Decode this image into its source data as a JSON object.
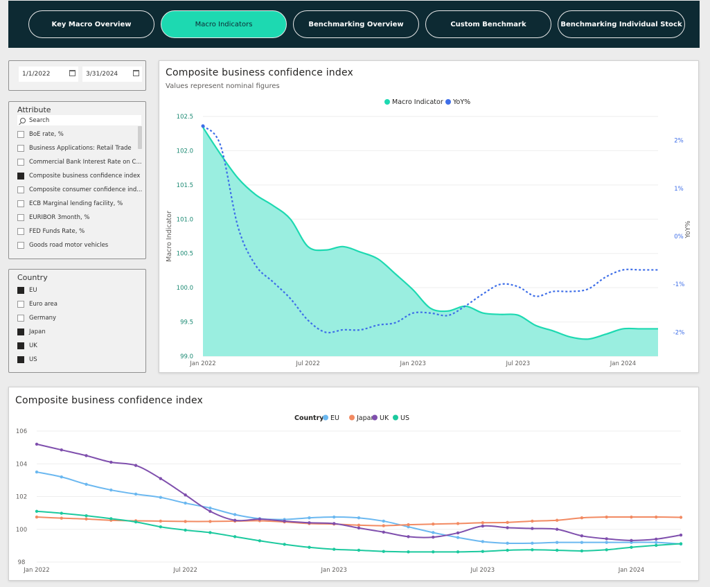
{
  "nav": {
    "tabs": [
      {
        "label": "Key Macro Overview"
      },
      {
        "label": "Macro Indicators"
      },
      {
        "label": "Benchmarking Overview"
      },
      {
        "label": "Custom Benchmark"
      },
      {
        "label": "Benchmarking Individual Stock"
      }
    ],
    "active_index": 1,
    "active_color": "#1dd9b1",
    "bar_color": "#0d2a33"
  },
  "date_range": {
    "start": "1/1/2022",
    "end": "3/31/2024"
  },
  "attribute_slicer": {
    "title": "Attribute",
    "search_placeholder": "Search",
    "items": [
      {
        "label": "BoE rate, %",
        "checked": false
      },
      {
        "label": "Business Applications: Retail Trade",
        "checked": false
      },
      {
        "label": "Commercial Bank Interest Rate on C...",
        "checked": false
      },
      {
        "label": "Composite business confidence index",
        "checked": true
      },
      {
        "label": "Composite consumer confidence ind...",
        "checked": false
      },
      {
        "label": "ECB Marginal lending facility, %",
        "checked": false
      },
      {
        "label": "EURIBOR 3month, %",
        "checked": false
      },
      {
        "label": "FED Funds Rate, %",
        "checked": false
      },
      {
        "label": "Goods road motor vehicles",
        "checked": false
      }
    ]
  },
  "country_slicer": {
    "title": "Country",
    "items": [
      {
        "label": "EU",
        "checked": true
      },
      {
        "label": "Euro area",
        "checked": false
      },
      {
        "label": "Germany",
        "checked": false
      },
      {
        "label": "Japan",
        "checked": true
      },
      {
        "label": "UK",
        "checked": true
      },
      {
        "label": "US",
        "checked": true
      }
    ]
  },
  "top_chart": {
    "title": "Composite business confidence index",
    "subtitle": "Values represent nominal figures"
  },
  "bottom_chart": {
    "title": "Composite business confidence index"
  },
  "chart_data": [
    {
      "type": "area",
      "title": "Composite business confidence index",
      "subtitle": "Values represent nominal figures",
      "xlabel": "",
      "ylabel": "Macro Indicator",
      "y2label": "YoY%",
      "x_ticks": [
        "Jan 2022",
        "Jul 2022",
        "Jan 2023",
        "Jul 2023",
        "Jan 2024"
      ],
      "x": [
        "2022-01",
        "2022-02",
        "2022-03",
        "2022-04",
        "2022-05",
        "2022-06",
        "2022-07",
        "2022-08",
        "2022-09",
        "2022-10",
        "2022-11",
        "2022-12",
        "2023-01",
        "2023-02",
        "2023-03",
        "2023-04",
        "2023-05",
        "2023-06",
        "2023-07",
        "2023-08",
        "2023-09",
        "2023-10",
        "2023-11",
        "2023-12",
        "2024-01",
        "2024-02",
        "2024-03"
      ],
      "ylim": [
        99.0,
        102.5
      ],
      "y_ticks": [
        "99.0",
        "99.5",
        "100.0",
        "100.5",
        "101.0",
        "101.5",
        "102.0",
        "102.5"
      ],
      "y2lim": [
        -2.5,
        2.5
      ],
      "y2_ticks": [
        "-2%",
        "-1%",
        "0%",
        "1%",
        "2%"
      ],
      "legend": {
        "position": "top-center",
        "entries": [
          "Macro Indicator",
          "YoY%"
        ]
      },
      "grid": true,
      "series": [
        {
          "name": "Macro Indicator",
          "axis": "left",
          "style": "area",
          "color": "#1dd9b1",
          "fill": "#9aeee0",
          "values": [
            102.34,
            101.95,
            101.6,
            101.36,
            101.2,
            101.0,
            100.6,
            100.55,
            100.6,
            100.52,
            100.42,
            100.2,
            99.97,
            99.7,
            99.66,
            99.73,
            99.63,
            99.61,
            99.6,
            99.45,
            99.37,
            99.28,
            99.25,
            99.32,
            99.4,
            99.4,
            99.4
          ]
        },
        {
          "name": "YoY%",
          "axis": "right",
          "style": "dotted",
          "color": "#3e6ee8",
          "values": [
            2.3,
            1.9,
            0.2,
            -0.6,
            -0.95,
            -1.3,
            -1.75,
            -2.0,
            -1.95,
            -1.95,
            -1.85,
            -1.8,
            -1.6,
            -1.6,
            -1.65,
            -1.45,
            -1.2,
            -1.0,
            -1.05,
            -1.25,
            -1.15,
            -1.15,
            -1.1,
            -0.85,
            -0.7,
            -0.7,
            -0.7
          ]
        }
      ]
    },
    {
      "type": "line",
      "title": "Composite business confidence index",
      "xlabel": "",
      "ylabel": "",
      "x_ticks": [
        "Jan 2022",
        "Jul 2022",
        "Jan 2023",
        "Jul 2023",
        "Jan 2024"
      ],
      "x": [
        "2022-01",
        "2022-02",
        "2022-03",
        "2022-04",
        "2022-05",
        "2022-06",
        "2022-07",
        "2022-08",
        "2022-09",
        "2022-10",
        "2022-11",
        "2022-12",
        "2023-01",
        "2023-02",
        "2023-03",
        "2023-04",
        "2023-05",
        "2023-06",
        "2023-07",
        "2023-08",
        "2023-09",
        "2023-10",
        "2023-11",
        "2023-12",
        "2024-01",
        "2024-02",
        "2024-03"
      ],
      "ylim": [
        98,
        106
      ],
      "y_ticks": [
        "98",
        "100",
        "102",
        "104",
        "106"
      ],
      "legend": {
        "title": "Country",
        "position": "top-center",
        "entries": [
          "EU",
          "Japan",
          "UK",
          "US"
        ]
      },
      "grid": true,
      "series": [
        {
          "name": "EU",
          "color": "#6bb8f0",
          "values": [
            103.5,
            103.2,
            102.75,
            102.4,
            102.15,
            101.95,
            101.6,
            101.3,
            100.9,
            100.65,
            100.6,
            100.7,
            100.75,
            100.7,
            100.5,
            100.15,
            99.8,
            99.5,
            99.25,
            99.15,
            99.15,
            99.2,
            99.2,
            99.2,
            99.2,
            99.2,
            99.1
          ]
        },
        {
          "name": "Japan",
          "color": "#f28a62",
          "values": [
            100.75,
            100.68,
            100.63,
            100.55,
            100.52,
            100.5,
            100.48,
            100.48,
            100.5,
            100.52,
            100.45,
            100.35,
            100.32,
            100.25,
            100.22,
            100.28,
            100.32,
            100.35,
            100.4,
            100.42,
            100.5,
            100.55,
            100.7,
            100.75,
            100.75,
            100.75,
            100.73
          ]
        },
        {
          "name": "UK",
          "color": "#7f4fad",
          "values": [
            105.2,
            104.85,
            104.5,
            104.1,
            103.9,
            103.1,
            102.1,
            101.1,
            100.55,
            100.62,
            100.5,
            100.4,
            100.35,
            100.08,
            99.83,
            99.55,
            99.52,
            99.78,
            100.2,
            100.1,
            100.05,
            100.0,
            99.6,
            99.42,
            99.32,
            99.4,
            99.65
          ]
        },
        {
          "name": "US",
          "color": "#1bc99e",
          "values": [
            101.1,
            100.98,
            100.83,
            100.65,
            100.45,
            100.15,
            99.95,
            99.8,
            99.55,
            99.3,
            99.08,
            98.9,
            98.78,
            98.72,
            98.65,
            98.62,
            98.62,
            98.62,
            98.65,
            98.72,
            98.75,
            98.72,
            98.68,
            98.75,
            98.9,
            99.02,
            99.12
          ]
        }
      ]
    }
  ]
}
